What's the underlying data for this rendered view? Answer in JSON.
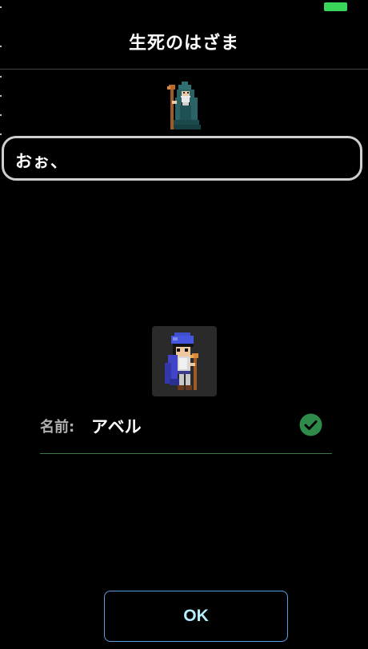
{
  "status_bar": {
    "battery_color": "#3ad65a"
  },
  "header": {
    "title": "生死のはざま"
  },
  "npc": {
    "icon": "sage-npc-icon"
  },
  "dialog": {
    "text": "おぉ、"
  },
  "character": {
    "icon": "hero-portrait-icon",
    "name_label": "名前:",
    "name_value": "アベル",
    "valid_icon": "check-circle-icon",
    "valid_color": "#2e8b4a"
  },
  "footer": {
    "ok_label": "OK",
    "ok_color": "#b7ecff",
    "ok_border": "#5aa0e8"
  }
}
